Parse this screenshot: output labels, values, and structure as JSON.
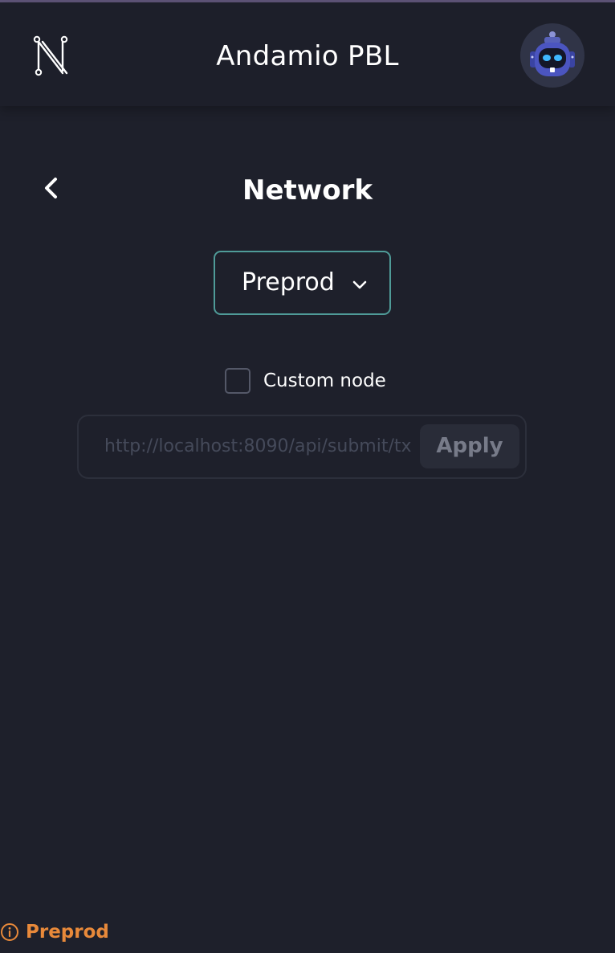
{
  "header": {
    "title": "Andamio PBL",
    "logo_icon": "n-circuit-logo-icon",
    "avatar_icon": "robot-avatar-icon"
  },
  "page": {
    "title": "Network",
    "back_icon": "chevron-left-icon"
  },
  "network_select": {
    "selected": "Preprod",
    "chevron_icon": "chevron-down-icon",
    "border_color": "#4f9b98"
  },
  "custom_node": {
    "label": "Custom node",
    "checked": false,
    "input_placeholder": "http://localhost:8090/api/submit/tx",
    "input_value": "",
    "apply_label": "Apply"
  },
  "status": {
    "icon": "info-icon",
    "label": "Preprod",
    "color": "#e8893a"
  },
  "colors": {
    "background": "#1e202b",
    "text": "#ffffff",
    "accent": "#4f9b98"
  }
}
